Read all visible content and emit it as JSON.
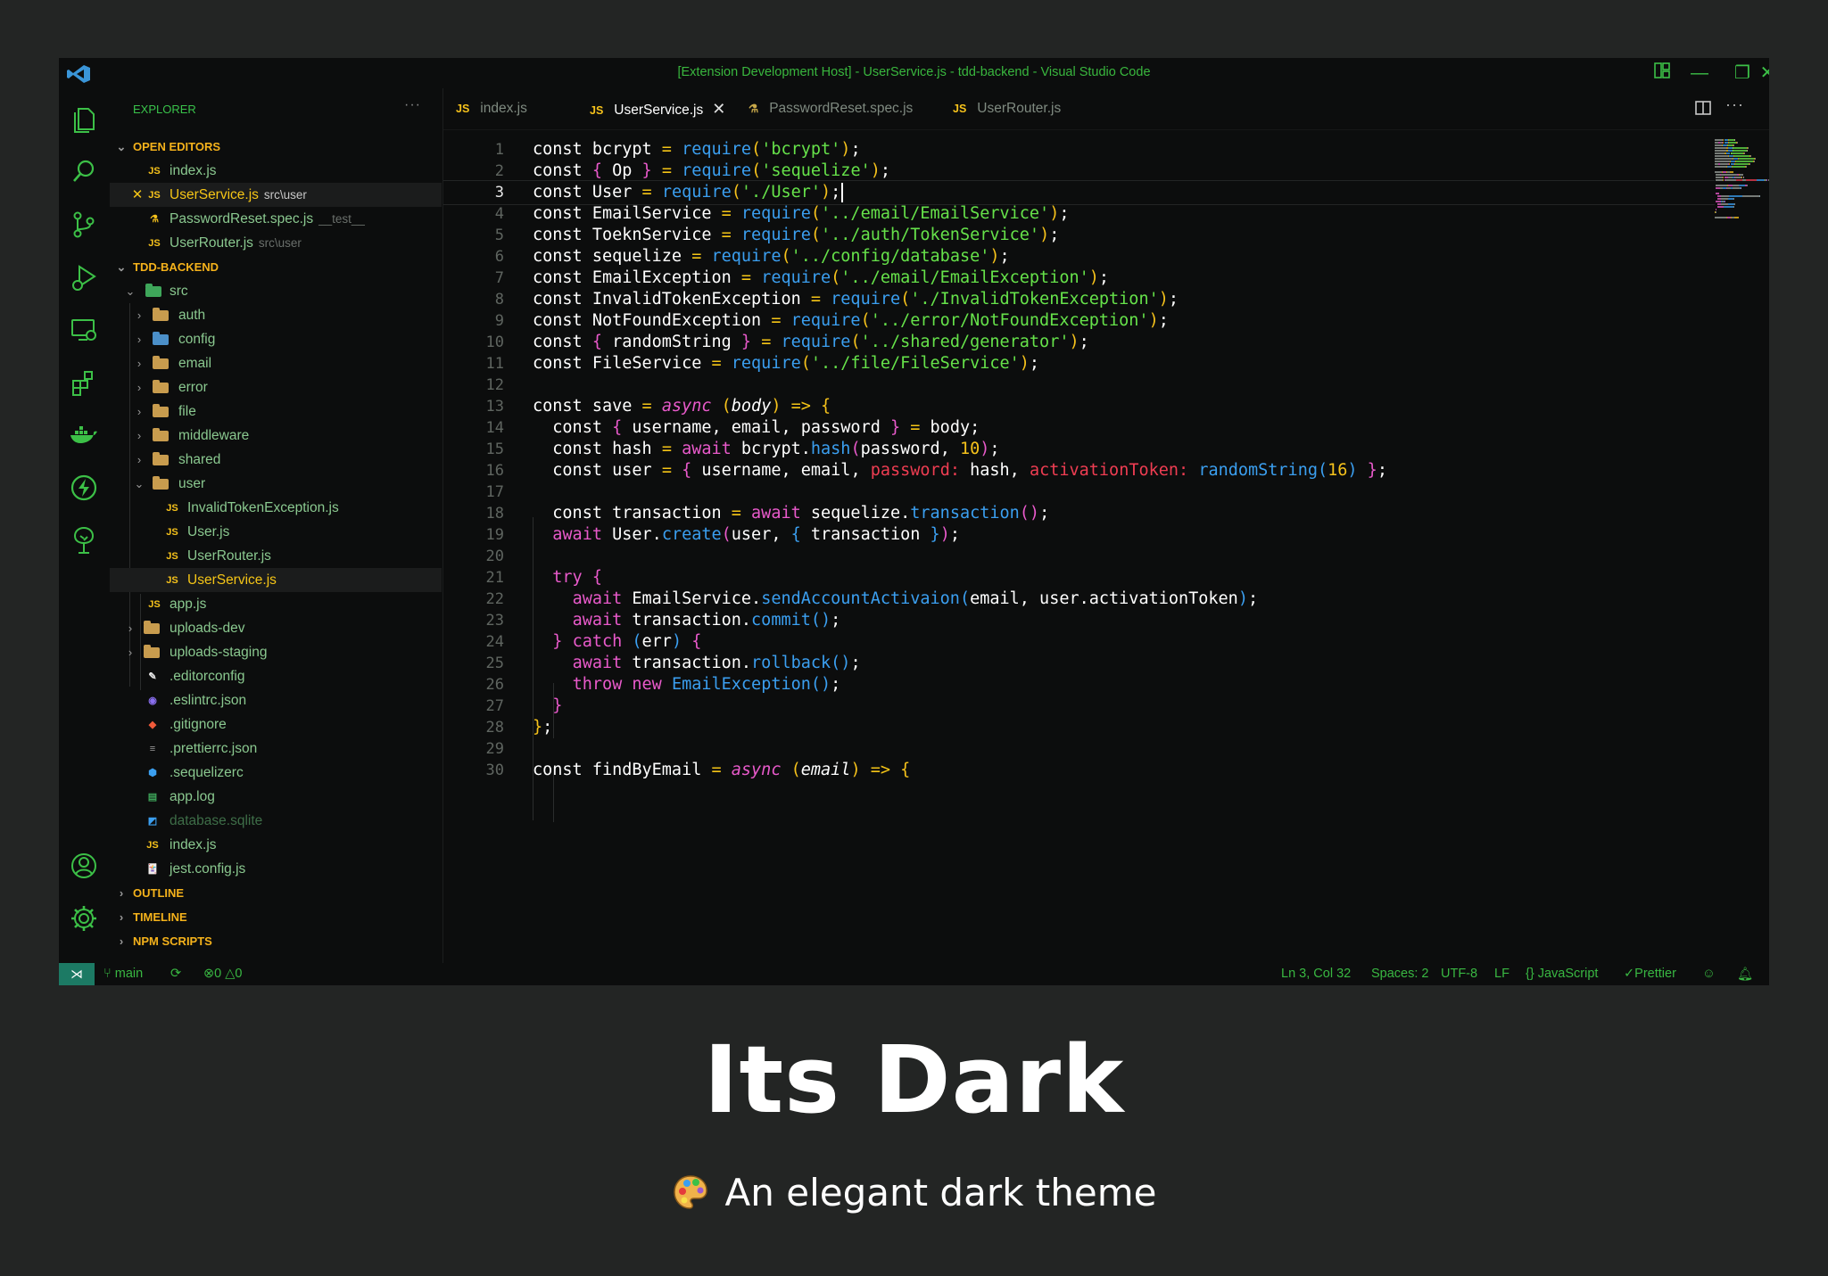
{
  "window": {
    "title": "[Extension Development Host] - UserService.js - tdd-backend - Visual Studio Code"
  },
  "activity_bar": [
    "files-icon",
    "search-icon",
    "source-control-icon",
    "run-debug-icon",
    "remote-explorer-icon",
    "extensions-icon",
    "docker-icon",
    "lightning-icon",
    "tree-icon",
    "account-icon",
    "settings-gear-icon"
  ],
  "sidebar": {
    "title": "EXPLORER",
    "open_editors_label": "OPEN EDITORS",
    "open_editors": [
      {
        "name": "index.js",
        "desc": ""
      },
      {
        "name": "UserService.js",
        "desc": "src\\user"
      },
      {
        "name": "PasswordReset.spec.js",
        "desc": "__test__"
      },
      {
        "name": "UserRouter.js",
        "desc": "src\\user"
      }
    ],
    "project_label": "TDD-BACKEND",
    "tree": {
      "src": "src",
      "folders": [
        "auth",
        "config",
        "email",
        "error",
        "file",
        "middleware",
        "shared",
        "user"
      ],
      "user_files": [
        "InvalidTokenException.js",
        "User.js",
        "UserRouter.js",
        "UserService.js"
      ],
      "app_js": "app.js",
      "root_items": [
        "uploads-dev",
        "uploads-staging",
        ".editorconfig",
        ".eslintrc.json",
        ".gitignore",
        ".prettierrc.json",
        ".sequelizerc",
        "app.log",
        "database.sqlite",
        "index.js",
        "jest.config.js"
      ]
    },
    "outline_label": "OUTLINE",
    "timeline_label": "TIMELINE",
    "npm_label": "NPM SCRIPTS"
  },
  "tabs": [
    {
      "label": "index.js"
    },
    {
      "label": "UserService.js"
    },
    {
      "label": "PasswordReset.spec.js"
    },
    {
      "label": "UserRouter.js"
    }
  ],
  "code_line_numbers": [
    "1",
    "2",
    "3",
    "4",
    "5",
    "6",
    "7",
    "8",
    "9",
    "10",
    "11",
    "12",
    "13",
    "14",
    "15",
    "16",
    "17",
    "18",
    "19",
    "20",
    "21",
    "22",
    "23",
    "24",
    "25",
    "26",
    "27",
    "28",
    "29",
    "30"
  ],
  "status": {
    "branch": "main",
    "errors": "0",
    "warnings": "0",
    "position": "Ln 3, Col 32",
    "spaces": "Spaces: 2",
    "encoding": "UTF-8",
    "eol": "LF",
    "language": "JavaScript",
    "formatter": "Prettier"
  },
  "hero": {
    "title": "Its Dark",
    "subtitle": "An elegant dark theme"
  },
  "colors": {
    "accent_green": "#39b742",
    "section_orange": "#f5b21b",
    "string_green": "#66e24a",
    "keyword_pink": "#e95acb",
    "function_blue": "#3b9ff0",
    "property_red": "#ef3d52",
    "background": "#232524",
    "editor_bg": "#0c0d0d"
  }
}
